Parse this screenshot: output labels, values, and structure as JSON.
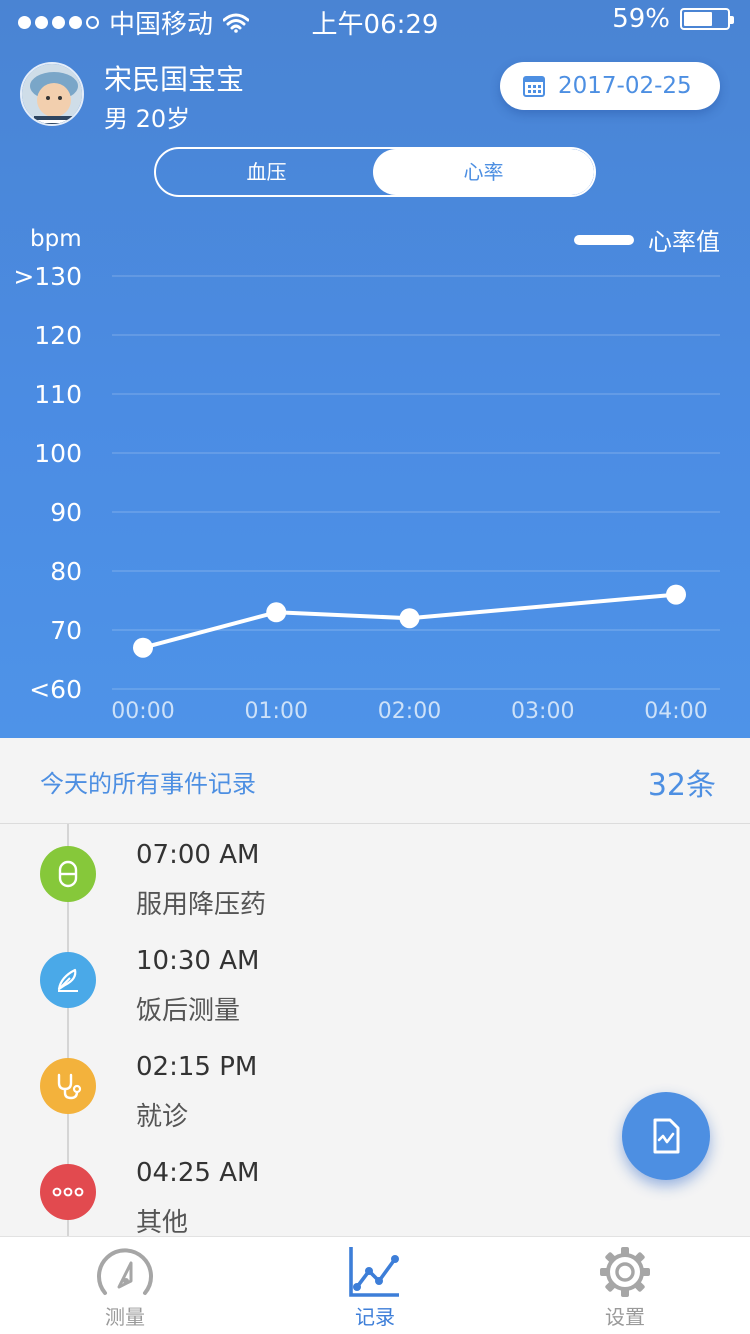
{
  "status_bar": {
    "carrier": "中国移动",
    "time": "上午06:29",
    "battery": "59%"
  },
  "user": {
    "name": "宋民国宝宝",
    "meta": "男 20岁",
    "date": "2017-02-25"
  },
  "segment": {
    "left_label": "血压",
    "right_label": "心率",
    "selected": "心率"
  },
  "chart_data": {
    "type": "line",
    "ylabel": "bpm",
    "y_tick_labels": [
      ">130",
      "120",
      "110",
      "100",
      "90",
      "80",
      "70",
      "<60"
    ],
    "ylim": [
      60,
      130
    ],
    "x": [
      "00:00",
      "01:00",
      "02:00",
      "03:00",
      "04:00"
    ],
    "series": [
      {
        "name": "心率值",
        "points": [
          {
            "x": "00:00",
            "y": 67
          },
          {
            "x": "01:00",
            "y": 73
          },
          {
            "x": "02:00",
            "y": 72
          },
          {
            "x": "04:00",
            "y": 76
          }
        ]
      }
    ],
    "grid": true,
    "legend": "top-right"
  },
  "records": {
    "title": "今天的所有事件记录",
    "count": "32条",
    "events": [
      {
        "time": "07:00 AM",
        "label": "服用降压药",
        "icon": "pill-icon",
        "color": "#86c83a"
      },
      {
        "time": "10:30 AM",
        "label": "饭后测量",
        "icon": "pen-icon",
        "color": "#4aa9e8"
      },
      {
        "time": "02:15 PM",
        "label": "就诊",
        "icon": "stethoscope-icon",
        "color": "#f3b23c"
      },
      {
        "time": "04:25 AM",
        "label": "其他",
        "icon": "more-icon",
        "color": "#e24a4f"
      }
    ]
  },
  "tabbar": {
    "tabs": [
      {
        "label": "测量",
        "icon": "gauge-icon",
        "active": false
      },
      {
        "label": "记录",
        "icon": "chart-icon",
        "active": true
      },
      {
        "label": "设置",
        "icon": "gear-icon",
        "active": false
      }
    ]
  },
  "colors": {
    "primary": "#4d8fe2",
    "header_top": "#4a84d3",
    "background": "#f4f4f4"
  }
}
